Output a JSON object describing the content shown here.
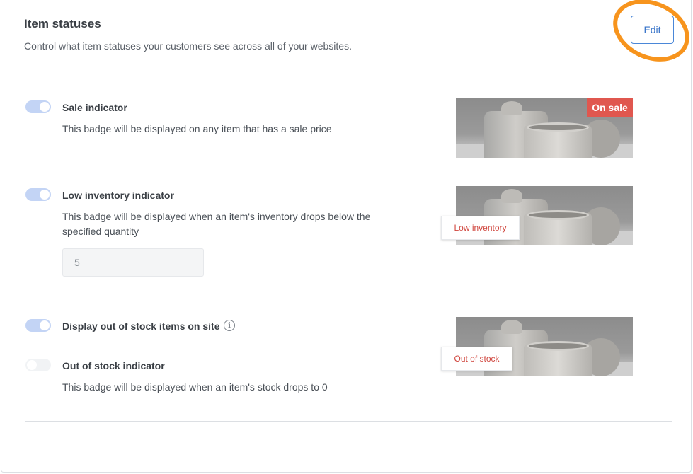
{
  "header": {
    "title": "Item statuses",
    "subtitle": "Control what item statuses your customers see across all of your websites.",
    "edit_label": "Edit"
  },
  "sections": {
    "sale": {
      "toggle_on": true,
      "label": "Sale indicator",
      "description": "This badge will be displayed on any item that has a sale price",
      "badge": "On sale"
    },
    "low_inventory": {
      "toggle_on": true,
      "label": "Low inventory indicator",
      "description": "This badge will be displayed when an item's inventory drops below the specified quantity",
      "quantity_value": "5",
      "badge": "Low inventory"
    },
    "out_of_stock": {
      "display_toggle_on": true,
      "display_label": "Display out of stock items on site",
      "info_icon": "info-icon",
      "indicator_toggle_on": false,
      "indicator_label": "Out of stock indicator",
      "indicator_description": "This badge will be displayed when an item's stock drops to 0",
      "badge": "Out of stock"
    }
  },
  "colors": {
    "accent": "#3673c9",
    "highlight": "#f7941d",
    "sale_badge": "#e0574f",
    "toggle_on": "#c3d4f5"
  }
}
